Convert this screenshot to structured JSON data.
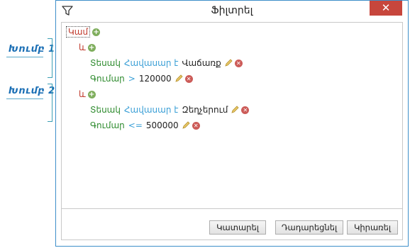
{
  "window": {
    "title": "Ֆիլտրել",
    "close_label": "✕"
  },
  "annotations": {
    "group1": "Խումբ 1",
    "group2": "Խումբ 2"
  },
  "filter": {
    "root_operator": "Կամ",
    "groups": [
      {
        "operator": "և",
        "conditions": [
          {
            "field": "Տեսակ",
            "op": "Հավասար է",
            "value": "Վաճառք"
          },
          {
            "field": "Գումար",
            "op": ">",
            "value": "120000"
          }
        ]
      },
      {
        "operator": "և",
        "conditions": [
          {
            "field": "Տեսակ",
            "op": "Հավասար է",
            "value": "Զեղչերում"
          },
          {
            "field": "Գումար",
            "op": "<=",
            "value": "500000"
          }
        ]
      }
    ]
  },
  "buttons": {
    "cancel": "Կատարել",
    "reset": "Դադարեցնել",
    "apply": "Կիրառել"
  },
  "icons": {
    "title": "filter-funnel-icon",
    "add": "plus-circle-icon",
    "remove": "x-circle-icon",
    "edit": "pencil-icon"
  }
}
